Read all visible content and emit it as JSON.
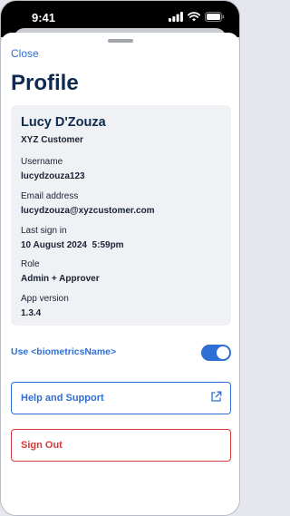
{
  "status_bar": {
    "time": "9:41",
    "icons": [
      "signal-icon",
      "wifi-icon",
      "battery-icon"
    ]
  },
  "sheet": {
    "close_label": "Close",
    "title": "Profile"
  },
  "profile": {
    "name": "Lucy D'Zouza",
    "customer": "XYZ Customer",
    "fields": [
      {
        "label": "Username",
        "value": "lucydzouza123"
      },
      {
        "label": "Email address",
        "value": "lucydzouza@xyzcustomer.com"
      },
      {
        "label": "Last sign in",
        "value": "10 August 2024  5:59pm"
      },
      {
        "label": "Role",
        "value": "Admin + Approver"
      },
      {
        "label": "App version",
        "value": "1.3.4"
      }
    ]
  },
  "biometrics": {
    "label": "Use <biometricsName>",
    "enabled": true
  },
  "buttons": {
    "help_label": "Help and Support",
    "help_icon": "external-link-icon",
    "signout_label": "Sign Out"
  },
  "colors": {
    "accent": "#2e6fd3",
    "danger": "#d43a3a",
    "title": "#0f2a4e",
    "card_bg": "#eff1f5"
  }
}
